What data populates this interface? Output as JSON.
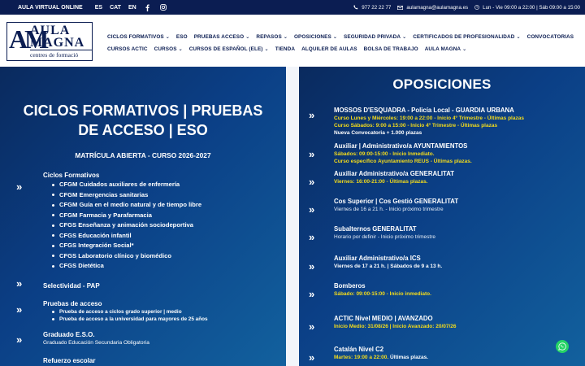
{
  "topbar": {
    "brand": "AULA VIRTUAL ONLINE",
    "languages": [
      "ES",
      "CAT",
      "EN"
    ],
    "social_icons": [
      "facebook-icon",
      "instagram-icon"
    ],
    "phone": "977 22 22 77",
    "email": "aulamagna@aulamagna.es",
    "hours": "Lun - Vie 09:00 a 22:00 | Sáb 09:00 a 15:00"
  },
  "logo": {
    "line1": "AULA",
    "line2": "MAGNA",
    "line3": "centres de formació",
    "mark": "AM"
  },
  "nav": {
    "row1": [
      {
        "label": "CICLOS FORMATIVOS",
        "dropdown": true
      },
      {
        "label": "ESO",
        "dropdown": false
      },
      {
        "label": "PRUEBAS ACCESO",
        "dropdown": true
      },
      {
        "label": "REPASOS",
        "dropdown": true
      },
      {
        "label": "OPOSICIONES",
        "dropdown": true
      },
      {
        "label": "SEGURIDAD PRIVADA",
        "dropdown": true
      },
      {
        "label": "CERTIFICADOS DE PROFESIONALIDAD",
        "dropdown": true
      },
      {
        "label": "CONVOCATORIAS",
        "dropdown": false
      }
    ],
    "row2": [
      {
        "label": "CURSOS ACTIC",
        "dropdown": false
      },
      {
        "label": "CURSOS",
        "dropdown": true
      },
      {
        "label": "CURSOS DE ESPAÑOL (ELE)",
        "dropdown": true
      },
      {
        "label": "TIENDA",
        "dropdown": false
      },
      {
        "label": "ALQUILER DE AULAS",
        "dropdown": false
      },
      {
        "label": "BOLSA DE TRABAJO",
        "dropdown": false
      },
      {
        "label": "AULA MAGNA",
        "dropdown": true
      }
    ]
  },
  "left": {
    "title": "CICLOS FORMATIVOS | PRUEBAS DE ACCESO | ESO",
    "subtitle": "MATRÍCULA ABIERTA - CURSO 2026-2027",
    "ciclos_heading": "Ciclos Formativos",
    "ciclos": [
      "CFGM Cuidados auxiliares de enfermería",
      "CFGM Emergencias sanitarias",
      "CFGM Guía en el medio natural y de tiempo libre",
      "CFGM Farmacia y Parafarmacia",
      "CFGS Enseñanza y animación sociodeportiva",
      "CFGS Educación infantil",
      "CFGS Integración Social*",
      "CFGS Laboratorio clínico y biomédico",
      "CFGS Dietética"
    ],
    "selectividad": "Selectividad - PAP",
    "pruebas_heading": "Pruebas de acceso",
    "pruebas": [
      "Prueba de acceso a ciclos grado superior | medio",
      "Prueba de acceso a la universidad para mayores de 25 años"
    ],
    "eso_heading": "Graduado E.S.O.",
    "eso_sub": "Graduado Educación Secundaria Obligatoria",
    "refuerzo_heading": "Refuerzo escolar"
  },
  "right": {
    "title": "OPOSICIONES",
    "items": [
      {
        "heading": "MOSSOS D'ESQUADRA - Policía Local - GUARDIA URBANA",
        "lines": [
          {
            "style": "y",
            "text": "Curso Lunes y Miércoles: 19:00 a 22:00 - Inicio 4º Trimestre - Últimas plazas"
          },
          {
            "style": "y",
            "text": "Curso Sábados: 9:00 a 15:00 - Inicio 4º Trimestre - Últimas plazas"
          },
          {
            "style": "w",
            "text": "Nueva Convocatoria + 1.000 plazas"
          }
        ]
      },
      {
        "heading": "Auxiliar | Administrativo/a AYUNTAMIENTOS",
        "lines": [
          {
            "style": "y",
            "text": "Sábados: 09:00-15:00 - Inicio Inmediato."
          },
          {
            "style": "y",
            "text": "Curso específico Ayuntamiento REUS - Últimas plazas."
          }
        ]
      },
      {
        "heading": "Auxiliar Administrativo/a GENERALITAT",
        "lines": [
          {
            "style": "y",
            "text": "Viernes: 16:00-21:00 - Últimas plazas."
          }
        ]
      },
      {
        "heading": "Cos Superior | Cos Gestió GENERALITAT",
        "lines": [
          {
            "style": "n",
            "text": "Viernes de 16 a 21 h. - Inicio próximo trimestre"
          }
        ]
      },
      {
        "heading": "Subalternos GENERALITAT",
        "lines": [
          {
            "style": "n",
            "text": "Horario por definir - Inicio próximo trimestre"
          }
        ]
      },
      {
        "heading": "Auxiliar Administrativo/a ICS",
        "lines": [
          {
            "style": "w",
            "text": "Viernes de 17 a 21 h. | Sábados de 9 a 13 h."
          }
        ]
      },
      {
        "heading": "Bomberos",
        "lines": [
          {
            "style": "y",
            "text": "Sábado: 09:00-15:00 - Inicio inmediato."
          }
        ]
      },
      {
        "heading": "ACTIC Nivel MEDIO | AVANZADO",
        "lines": [
          {
            "style": "y",
            "text": "Inicio Medio: 31/08/26 | Inicio Avanzado: 20/07/26"
          }
        ]
      },
      {
        "heading": "Catalán Nivel C2",
        "mix": {
          "yellow": "Martes: 19:00 a 22:00.",
          "white": " Últimas plazas."
        }
      }
    ]
  },
  "whatsapp_icon": "whatsapp-icon",
  "colors": {
    "navy": "#0b1d52",
    "panel": "#0b3f86",
    "highlight": "#f4dc1b",
    "whatsapp": "#25d366"
  }
}
